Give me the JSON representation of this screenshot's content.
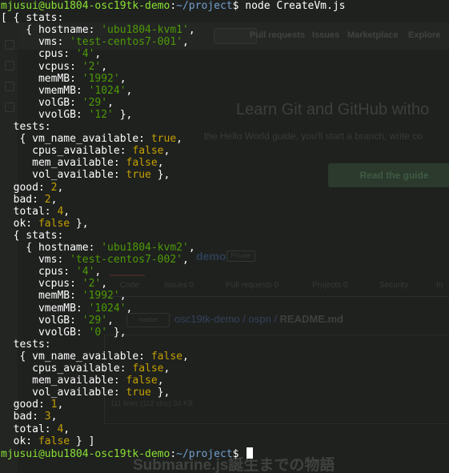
{
  "background": {
    "nav_items": [
      "Pull requests",
      "Issues",
      "Marketplace",
      "Explore"
    ],
    "hero_title": "Learn Git and GitHub witho",
    "hero_sub": "the Hello World guide, you'll start a branch, write co",
    "guide_button": "Read the guide",
    "repo_name": "demo",
    "repo_badge": "Private",
    "tabs": [
      "Code",
      "Issues 0",
      "Pull requests 0",
      "Projects 0",
      "Security",
      "In"
    ],
    "branch": "master",
    "path_repo": "osc19tk-demo",
    "path_dir": "ospn",
    "path_file": "README.md",
    "file_info": "111 lines (112 sloc)  34 KB",
    "bottom_heading": "Submarine.js誕生までの物語"
  },
  "terminal": {
    "prompt_user": "mjusui@ubu1804-osc19tk-demo",
    "prompt_path": "~/project",
    "prompt_symbol": "$",
    "command": "node CreateVm.js",
    "results": [
      {
        "stats": {
          "hostname": "'ubu1804-kvm1'",
          "vms": "'test-centos7-001'",
          "cpus": "'4'",
          "vcpus": "'2'",
          "memMB": "'1992'",
          "vmemMB": "'1024'",
          "volGB": "'29'",
          "vvolGB": "'12'"
        },
        "tests": {
          "vm_name_available": "true",
          "cpus_available": "false",
          "mem_available": "false",
          "vol_available": "true"
        },
        "good": "2",
        "bad": "2",
        "total": "4",
        "ok": "false"
      },
      {
        "stats": {
          "hostname": "'ubu1804-kvm2'",
          "vms": "'test-centos7-002'",
          "cpus": "'4'",
          "vcpus": "'2'",
          "memMB": "'1992'",
          "vmemMB": "'1024'",
          "volGB": "'29'",
          "vvolGB": "'0'"
        },
        "tests": {
          "vm_name_available": "false",
          "cpus_available": "false",
          "mem_available": "false",
          "vol_available": "true"
        },
        "good": "1",
        "bad": "3",
        "total": "4",
        "ok": "false"
      }
    ]
  },
  "colors": {
    "prompt_user": "#8ae234",
    "prompt_path": "#729fcf",
    "string": "#4e9a06",
    "number": "#c4a000",
    "boolean": "#c4a000",
    "text": "#ffffff"
  }
}
